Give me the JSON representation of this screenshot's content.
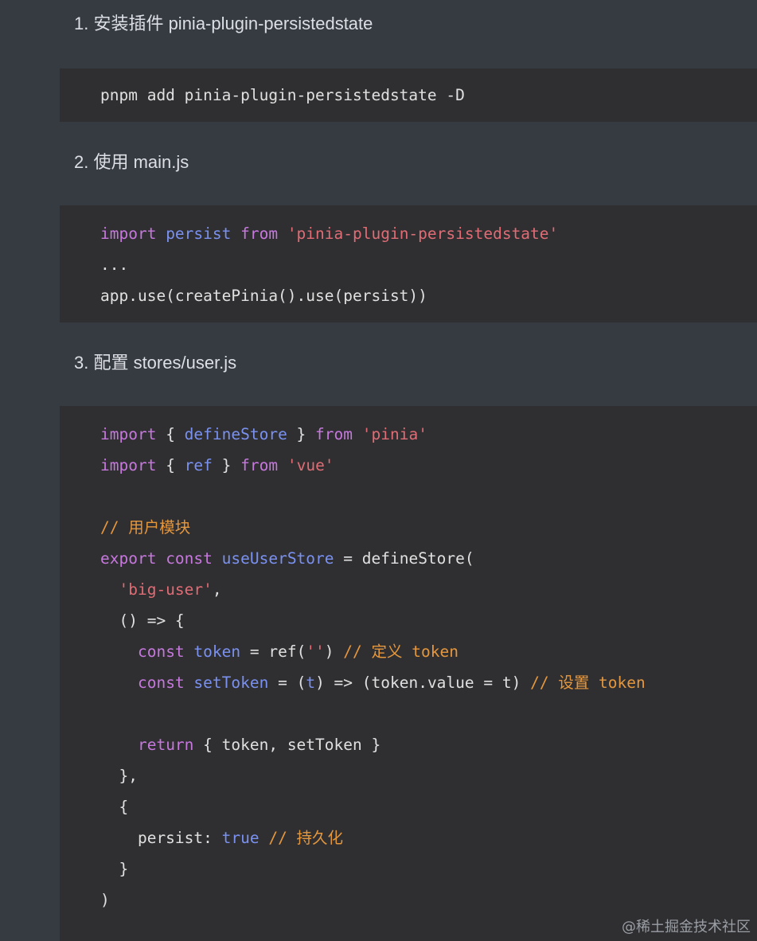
{
  "steps": [
    {
      "heading": "1. 安装插件 pinia-plugin-persistedstate"
    },
    {
      "heading": "2. 使用 main.js"
    },
    {
      "heading": "3. 配置 stores/user.js"
    }
  ],
  "code_blocks": [
    {
      "lines": [
        [
          {
            "t": "pnpm add pinia-plugin-persistedstate -D",
            "c": "id"
          }
        ]
      ]
    },
    {
      "lines": [
        [
          {
            "t": "import ",
            "c": "kw"
          },
          {
            "t": "persist ",
            "c": "vr"
          },
          {
            "t": "from ",
            "c": "kw"
          },
          {
            "t": "'pinia-plugin-persistedstate'",
            "c": "str"
          }
        ],
        [
          {
            "t": "...",
            "c": "id"
          }
        ],
        [
          {
            "t": "app.use(createPinia().use(persist))",
            "c": "id"
          }
        ]
      ]
    },
    {
      "lines": [
        [
          {
            "t": "import ",
            "c": "kw"
          },
          {
            "t": "{ ",
            "c": "id"
          },
          {
            "t": "defineStore",
            "c": "vr"
          },
          {
            "t": " } ",
            "c": "id"
          },
          {
            "t": "from ",
            "c": "kw"
          },
          {
            "t": "'pinia'",
            "c": "str"
          }
        ],
        [
          {
            "t": "import ",
            "c": "kw"
          },
          {
            "t": "{ ",
            "c": "id"
          },
          {
            "t": "ref",
            "c": "vr"
          },
          {
            "t": " } ",
            "c": "id"
          },
          {
            "t": "from ",
            "c": "kw"
          },
          {
            "t": "'vue'",
            "c": "str"
          }
        ],
        [],
        [
          {
            "t": "// 用户模块",
            "c": "cm"
          }
        ],
        [
          {
            "t": "export ",
            "c": "kw"
          },
          {
            "t": "const ",
            "c": "kw"
          },
          {
            "t": "useUserStore",
            "c": "vr"
          },
          {
            "t": " = defineStore(",
            "c": "id"
          }
        ],
        [
          {
            "t": "  ",
            "c": "id"
          },
          {
            "t": "'big-user'",
            "c": "str"
          },
          {
            "t": ",",
            "c": "id"
          }
        ],
        [
          {
            "t": "  () => {",
            "c": "id"
          }
        ],
        [
          {
            "t": "    ",
            "c": "id"
          },
          {
            "t": "const ",
            "c": "kw"
          },
          {
            "t": "token",
            "c": "vr"
          },
          {
            "t": " = ref(",
            "c": "id"
          },
          {
            "t": "''",
            "c": "str"
          },
          {
            "t": ") ",
            "c": "id"
          },
          {
            "t": "// 定义 token",
            "c": "cm"
          }
        ],
        [
          {
            "t": "    ",
            "c": "id"
          },
          {
            "t": "const ",
            "c": "kw"
          },
          {
            "t": "setToken",
            "c": "vr"
          },
          {
            "t": " = (",
            "c": "id"
          },
          {
            "t": "t",
            "c": "vr"
          },
          {
            "t": ") => (token.value = t) ",
            "c": "id"
          },
          {
            "t": "// 设置 token",
            "c": "cm"
          }
        ],
        [],
        [
          {
            "t": "    ",
            "c": "id"
          },
          {
            "t": "return ",
            "c": "kw"
          },
          {
            "t": "{ token, setToken }",
            "c": "id"
          }
        ],
        [
          {
            "t": "  },",
            "c": "id"
          }
        ],
        [
          {
            "t": "  {",
            "c": "id"
          }
        ],
        [
          {
            "t": "    persist: ",
            "c": "id"
          },
          {
            "t": "true ",
            "c": "vr"
          },
          {
            "t": "// 持久化",
            "c": "cm"
          }
        ],
        [
          {
            "t": "  }",
            "c": "id"
          }
        ],
        [
          {
            "t": ")",
            "c": "id"
          }
        ]
      ]
    }
  ],
  "watermark": "@稀土掘金技术社区",
  "colors": {
    "page_background": "#363a41",
    "code_background": "#2f2f31",
    "keyword": "#c678dd",
    "variable": "#7a91f0",
    "string": "#e06c75",
    "comment": "#e5973e",
    "plain": "#e0e0e0"
  }
}
